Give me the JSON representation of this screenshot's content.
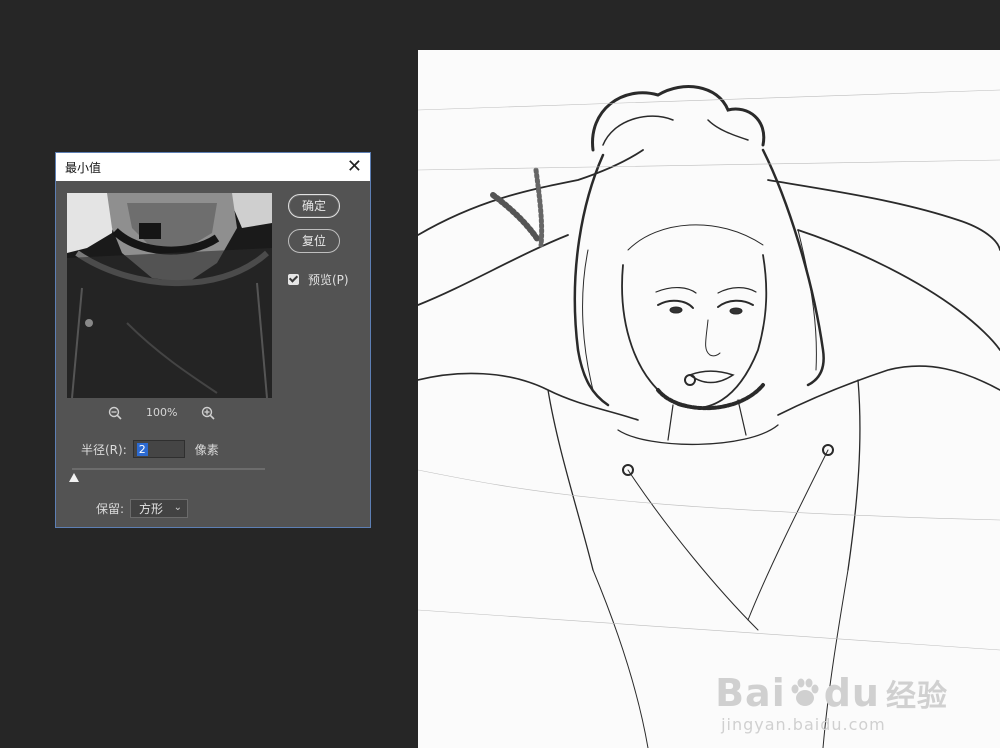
{
  "dialog": {
    "title": "最小值",
    "close_glyph": "✕",
    "ok_label": "确定",
    "reset_label": "复位",
    "preview_checkbox": {
      "label": "预览(P)",
      "checked": true
    },
    "zoom": {
      "percent": "100%",
      "zoom_out_icon": "zoom-out-icon",
      "zoom_in_icon": "zoom-in-icon"
    },
    "radius": {
      "label": "半径(R):",
      "value": "2",
      "unit": "像素",
      "slider_fraction": 0.01
    },
    "preserve": {
      "label": "保留:",
      "selected": "方形"
    }
  },
  "watermark": {
    "logo_text_1": "Bai",
    "logo_text_2": "du",
    "logo_suffix": "经验",
    "url": "jingyan.baidu.com"
  },
  "colors": {
    "workspace": "#262626",
    "dialog_bg": "#535353",
    "dialog_border": "#5d7fb4",
    "selection": "#2c6ad1"
  }
}
